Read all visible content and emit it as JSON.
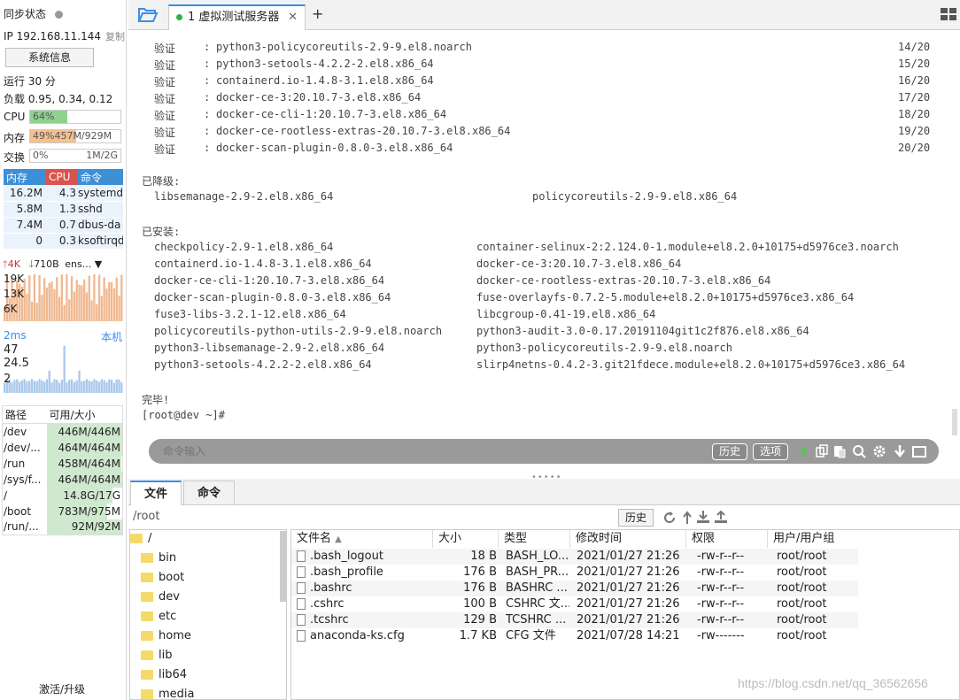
{
  "sidebar": {
    "sync_status": "同步状态",
    "ip": "IP 192.168.11.144",
    "copy": "复制",
    "sysinfo": "系统信息",
    "uptime": "运行 30 分",
    "load": "负载 0.95, 0.34, 0.12",
    "cpu_label": "CPU",
    "cpu_text": "64%",
    "cpu_fraction": 0.64,
    "mem_label": "内存",
    "mem_text": "49%457M/929M",
    "mem_fraction": 0.49,
    "swap_label": "交换",
    "swap_text": "0%",
    "swap_size": "1M/2G",
    "proc_headers": [
      "内存",
      "CPU",
      "命令"
    ],
    "processes": [
      {
        "mem": "16.2M",
        "cpu": "4.3",
        "cmd": "systemd"
      },
      {
        "mem": "5.8M",
        "cpu": "1.3",
        "cmd": "sshd"
      },
      {
        "mem": "7.4M",
        "cpu": "0.7",
        "cmd": "dbus-da"
      },
      {
        "mem": "0",
        "cpu": "0.3",
        "cmd": "ksoftirqd"
      }
    ],
    "net_up": "4K",
    "net_down": "710B",
    "net_iface": "ens...",
    "net_ylabels": [
      "19K",
      "13K",
      "6K"
    ],
    "ping_ms": "2ms",
    "ping_host": "本机",
    "ping_ylabels": [
      "47",
      "24.5",
      "2"
    ],
    "path_headers": [
      "路径",
      "可用/大小"
    ],
    "paths": [
      {
        "path": "/dev",
        "size": "446M/446M",
        "frac": 1.0
      },
      {
        "path": "/dev/...",
        "size": "464M/464M",
        "frac": 1.0
      },
      {
        "path": "/run",
        "size": "458M/464M",
        "frac": 0.99
      },
      {
        "path": "/sys/f...",
        "size": "464M/464M",
        "frac": 1.0
      },
      {
        "path": "/",
        "size": "14.8G/17G",
        "frac": 0.87
      },
      {
        "path": "/boot",
        "size": "783M/975M",
        "frac": 0.8
      },
      {
        "path": "/run/...",
        "size": "92M/92M",
        "frac": 1.0
      }
    ],
    "activate": "激活/升级"
  },
  "tabs": {
    "session_tab": "1 虚拟测试服务器",
    "close": "✕",
    "add": "+"
  },
  "terminal": {
    "verify_label": "验证",
    "verify_lines": [
      {
        "pkg": "python3-policycoreutils-2.9-9.el8.noarch",
        "n": "14/20"
      },
      {
        "pkg": "python3-setools-4.2.2-2.el8.x86_64",
        "n": "15/20"
      },
      {
        "pkg": "containerd.io-1.4.8-3.1.el8.x86_64",
        "n": "16/20"
      },
      {
        "pkg": "docker-ce-3:20.10.7-3.el8.x86_64",
        "n": "17/20"
      },
      {
        "pkg": "docker-ce-cli-1:20.10.7-3.el8.x86_64",
        "n": "18/20"
      },
      {
        "pkg": "docker-ce-rootless-extras-20.10.7-3.el8.x86_64",
        "n": "19/20"
      },
      {
        "pkg": "docker-scan-plugin-0.8.0-3.el8.x86_64",
        "n": "20/20"
      }
    ],
    "downgraded_title": "已降级:",
    "downgraded": [
      "libsemanage-2.9-2.el8.x86_64",
      "policycoreutils-2.9-9.el8.x86_64"
    ],
    "installed_title": "已安装:",
    "installed": [
      [
        "checkpolicy-2.9-1.el8.x86_64",
        "container-selinux-2:2.124.0-1.module+el8.2.0+10175+d5976ce3.noarch"
      ],
      [
        "containerd.io-1.4.8-3.1.el8.x86_64",
        "docker-ce-3:20.10.7-3.el8.x86_64"
      ],
      [
        "docker-ce-cli-1:20.10.7-3.el8.x86_64",
        "docker-ce-rootless-extras-20.10.7-3.el8.x86_64"
      ],
      [
        "docker-scan-plugin-0.8.0-3.el8.x86_64",
        "fuse-overlayfs-0.7.2-5.module+el8.2.0+10175+d5976ce3.x86_64"
      ],
      [
        "fuse3-libs-3.2.1-12.el8.x86_64",
        "libcgroup-0.41-19.el8.x86_64"
      ],
      [
        "policycoreutils-python-utils-2.9-9.el8.noarch",
        "python3-audit-3.0-0.17.20191104git1c2f876.el8.x86_64"
      ],
      [
        "python3-libsemanage-2.9-2.el8.x86_64",
        "python3-policycoreutils-2.9-9.el8.noarch"
      ],
      [
        "python3-setools-4.2.2-2.el8.x86_64",
        "slirp4netns-0.4.2-3.git21fdece.module+el8.2.0+10175+d5976ce3.x86_64"
      ]
    ],
    "done": "完毕!",
    "prompt": "[root@dev ~]#"
  },
  "cmdbar": {
    "placeholder": "命令输入",
    "history": "历史",
    "options": "选项"
  },
  "lower_tabs": [
    "文件",
    "命令"
  ],
  "filebar": {
    "path": "/root",
    "history": "历史"
  },
  "tree": {
    "root": "/",
    "items": [
      "bin",
      "boot",
      "dev",
      "etc",
      "home",
      "lib",
      "lib64",
      "media"
    ]
  },
  "files": {
    "headers": [
      "文件名",
      "大小",
      "类型",
      "修改时间",
      "权限",
      "用户/用户组"
    ],
    "rows": [
      {
        "name": ".bash_logout",
        "size": "18 B",
        "type": "BASH_LO...",
        "mtime": "2021/01/27 21:26",
        "perm": "-rw-r--r--",
        "owner": "root/root"
      },
      {
        "name": ".bash_profile",
        "size": "176 B",
        "type": "BASH_PR...",
        "mtime": "2021/01/27 21:26",
        "perm": "-rw-r--r--",
        "owner": "root/root"
      },
      {
        "name": ".bashrc",
        "size": "176 B",
        "type": "BASHRC ...",
        "mtime": "2021/01/27 21:26",
        "perm": "-rw-r--r--",
        "owner": "root/root"
      },
      {
        "name": ".cshrc",
        "size": "100 B",
        "type": "CSHRC 文...",
        "mtime": "2021/01/27 21:26",
        "perm": "-rw-r--r--",
        "owner": "root/root"
      },
      {
        "name": ".tcshrc",
        "size": "129 B",
        "type": "TCSHRC ...",
        "mtime": "2021/01/27 21:26",
        "perm": "-rw-r--r--",
        "owner": "root/root"
      },
      {
        "name": "anaconda-ks.cfg",
        "size": "1.7 KB",
        "type": "CFG 文件",
        "mtime": "2021/07/28 14:21",
        "perm": "-rw-------",
        "owner": "root/root"
      }
    ]
  },
  "watermark": "https://blog.csdn.net/qq_36562656",
  "colors": {
    "cpu": "#8fd18f",
    "mem": "#f5c08f",
    "mem_header": "#3d8fd6",
    "cpu_header": "#d9534f",
    "accent": "#3a8ee6"
  }
}
